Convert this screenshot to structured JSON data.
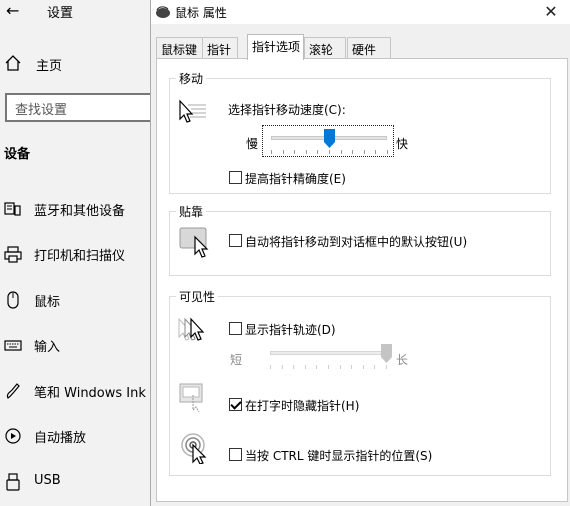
{
  "settings": {
    "back_icon": "back-arrow-icon",
    "title": "设置",
    "home": {
      "icon": "home-icon",
      "label": "主页"
    },
    "search": {
      "placeholder": "查找设置",
      "icon": "search-icon"
    },
    "section": "设备",
    "items": [
      {
        "icon": "bluetooth-devices-icon",
        "label": "蓝牙和其他设备"
      },
      {
        "icon": "printer-icon",
        "label": "打印机和扫描仪"
      },
      {
        "icon": "mouse-icon",
        "label": "鼠标"
      },
      {
        "icon": "keyboard-icon",
        "label": "输入"
      },
      {
        "icon": "pen-icon",
        "label": "笔和 Windows Ink"
      },
      {
        "icon": "autoplay-icon",
        "label": "自动播放"
      },
      {
        "icon": "usb-icon",
        "label": "USB"
      }
    ]
  },
  "dialog": {
    "title": "鼠标 属性",
    "close": "✕",
    "tabs": [
      "鼠标键",
      "指针",
      "指针选项",
      "滚轮",
      "硬件"
    ],
    "active_tab": 2,
    "motion": {
      "legend": "移动",
      "speed_label": "选择指针移动速度(C):",
      "slow": "慢",
      "fast": "快",
      "speed_value": 0.5,
      "precision_label": "提高指针精确度(E)",
      "precision_checked": false
    },
    "snap": {
      "legend": "贴靠",
      "label": "自动将指针移动到对话框中的默认按钮(U)",
      "checked": false
    },
    "visibility": {
      "legend": "可见性",
      "trails_label": "显示指针轨迹(D)",
      "trails_checked": false,
      "short": "短",
      "long": "长",
      "trails_value": 1.0,
      "hide_label": "在打字时隐藏指针(H)",
      "hide_checked": true,
      "ctrl_label": "当按 CTRL 键时显示指针的位置(S)",
      "ctrl_checked": false
    }
  },
  "colors": {
    "accent": "#0078d7",
    "background": "#f2f2f2",
    "panel": "#ffffff"
  }
}
